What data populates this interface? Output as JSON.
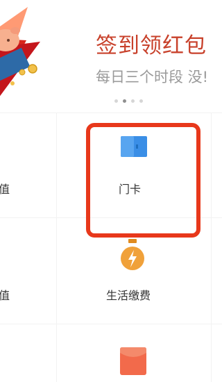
{
  "banner": {
    "title": "签到领红包",
    "subtitle": "每日三个时段 没!",
    "carousel_pages": 4,
    "carousel_active": 2
  },
  "services": [
    {
      "label": "值",
      "icon": "none"
    },
    {
      "label": "门卡",
      "icon": "door-card-icon"
    },
    {
      "label": "值",
      "icon": "none"
    },
    {
      "label": "生活缴费",
      "icon": "lightbulb-bolt-icon"
    },
    {
      "label": "",
      "icon": "red-packet-icon"
    }
  ],
  "colors": {
    "title": "#c8412b",
    "highlight": "#e8381b",
    "card_blue": "#3a8ee6",
    "bulb_orange": "#f0a13a",
    "packet_red": "#f26a4b"
  }
}
